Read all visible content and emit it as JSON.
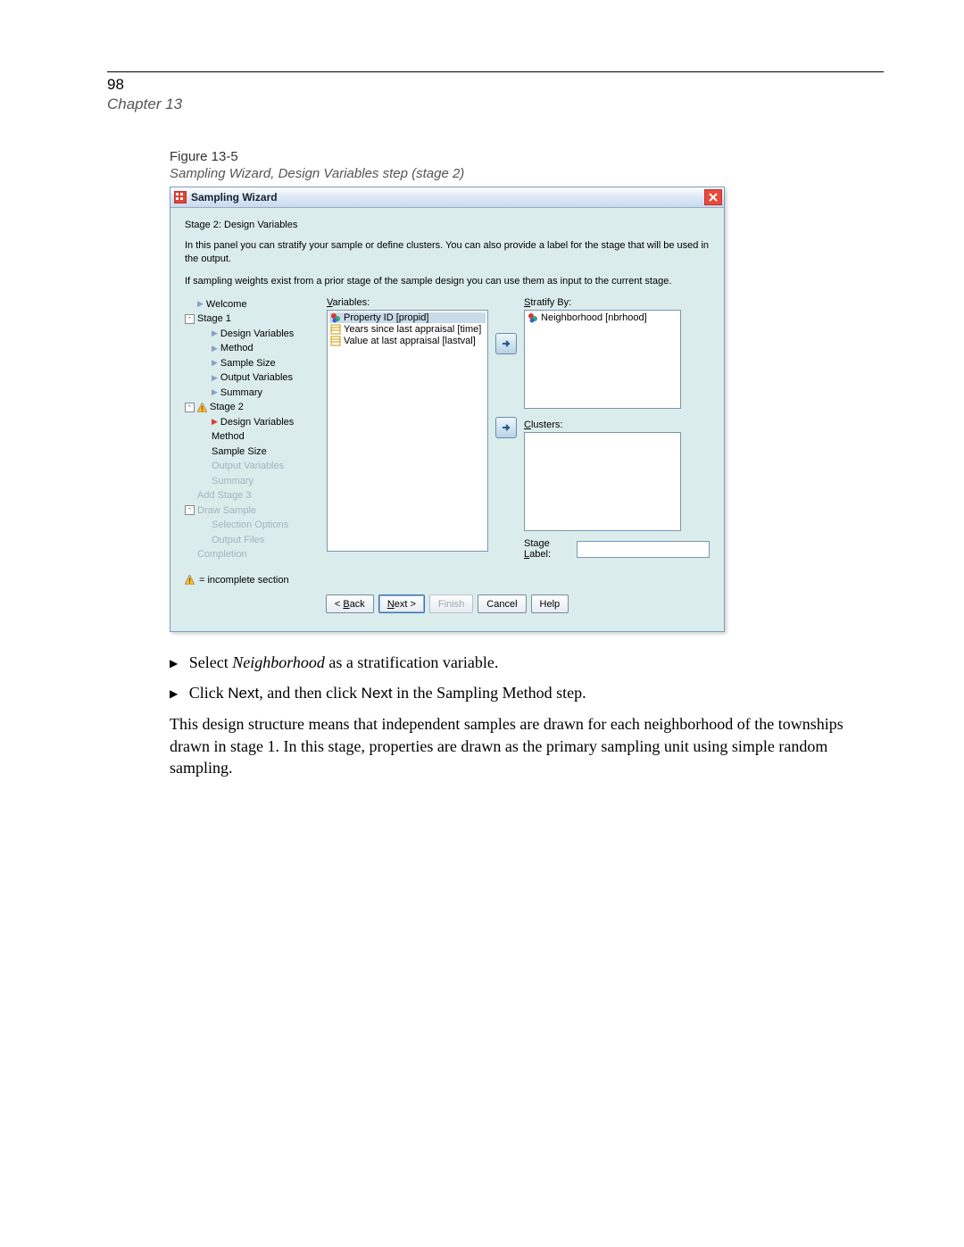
{
  "page": {
    "number": "98",
    "chapter": "Chapter 13"
  },
  "figure": {
    "number": "Figure 13-5",
    "caption": "Sampling Wizard, Design Variables step (stage 2)"
  },
  "dialog": {
    "title": "Sampling Wizard",
    "stage_heading": "Stage 2: Design Variables",
    "description1": "In this panel you can stratify your sample or define clusters. You can also provide a label for the stage that will be used in the output.",
    "description2": "If sampling weights exist from a prior stage of the sample design you can use them as input to the current stage.",
    "tree": {
      "welcome": "Welcome",
      "stage1": "Stage 1",
      "s1": {
        "design": "Design Variables",
        "method": "Method",
        "size": "Sample Size",
        "outvars": "Output Variables",
        "summary": "Summary"
      },
      "stage2": "Stage 2",
      "s2": {
        "design": "Design Variables",
        "method": "Method",
        "size": "Sample Size",
        "outvars": "Output Variables",
        "summary": "Summary"
      },
      "addstage": "Add Stage 3",
      "draw": "Draw Sample",
      "draw_sub": {
        "sel": "Selection Options",
        "out": "Output Files"
      },
      "completion": "Completion"
    },
    "labels": {
      "variables": "Variables:",
      "stratify": "Stratify By:",
      "clusters": "Clusters:",
      "stage_label": "Stage Label:"
    },
    "variables_list": [
      {
        "name": "Property ID [propid]",
        "kind": "nominal",
        "selected": true
      },
      {
        "name": "Years since last appraisal [time]",
        "kind": "scale",
        "selected": false
      },
      {
        "name": "Value at last appraisal [lastval]",
        "kind": "scale",
        "selected": false
      }
    ],
    "stratify_list": [
      {
        "name": "Neighborhood [nbrhood]",
        "kind": "nominal"
      }
    ],
    "legend": "= incomplete section",
    "buttons": {
      "back": "< Back",
      "next": "Next >",
      "finish": "Finish",
      "cancel": "Cancel",
      "help": "Help"
    }
  },
  "prose": {
    "step1_a": "Select ",
    "step1_b": "Neighborhood",
    "step1_c": " as a stratification variable.",
    "step2_a": "Click ",
    "step2_b": "Next",
    "step2_c": ", and then click ",
    "step2_d": "Next",
    "step2_e": " in the Sampling Method step.",
    "para": "This design structure means that independent samples are drawn for each neighborhood of the townships drawn in stage 1. In this stage, properties are drawn as the primary sampling unit using simple random sampling."
  }
}
